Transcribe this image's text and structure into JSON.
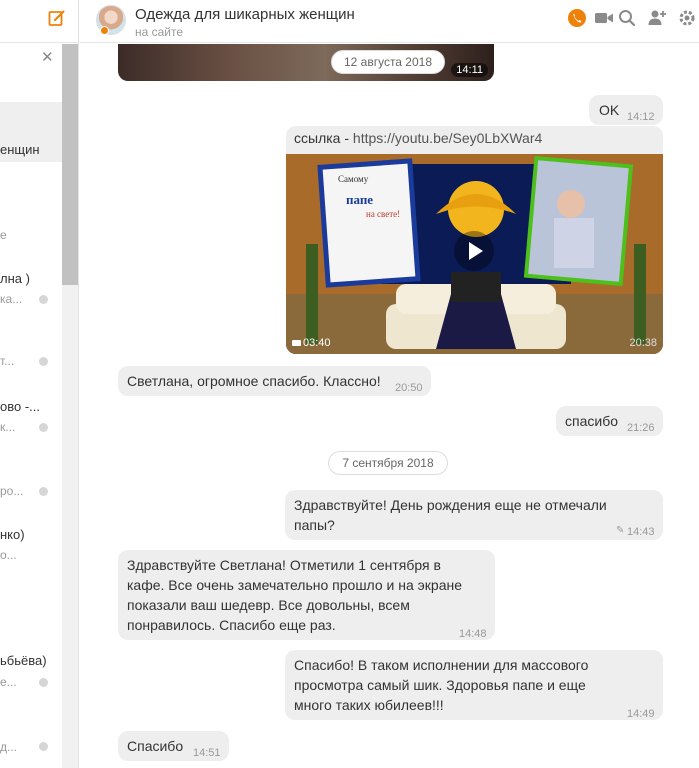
{
  "header": {
    "title": "Одежда для шикарных женщин",
    "status": "на сайте"
  },
  "sidebar": {
    "items": [
      {
        "name": "енщин",
        "sub": "",
        "active": true
      },
      {
        "name": "е",
        "sub": ""
      },
      {
        "name": "лна )",
        "sub": "ка..."
      },
      {
        "name": "",
        "sub": "т..."
      },
      {
        "name": "ово -...",
        "sub": "к..."
      },
      {
        "name": "",
        "sub": "ро..."
      },
      {
        "name": "нко)",
        "sub": "о..."
      },
      {
        "name": "ьбьёва)",
        "sub": "е..."
      },
      {
        "name": "",
        "sub": "д..."
      }
    ]
  },
  "messages": {
    "date1": "12 августа 2018",
    "img_time": "14:11",
    "ok": {
      "text": "OK",
      "time": "14:12"
    },
    "link": {
      "prefix": "ссылка - ",
      "url": "https://youtu.be/Sey0LbXWar4",
      "duration": "03:40",
      "time": "20:38"
    },
    "thanks_in": {
      "text": "Светлана, огромное спасибо. Классно!",
      "time": "20:50"
    },
    "thanks_out": {
      "text": "спасибо",
      "time": "21:26"
    },
    "date2": "7 сентября 2018",
    "hello_out": {
      "text": "Здравствуйте! День рождения еще не отмечали папы?",
      "time": "14:43"
    },
    "reply_in": {
      "text": "Здравствуйте Светлана! Отметили 1 сентября в кафе. Все очень замечательно прошло и на экране показали ваш шедевр. Все довольны, всем понравилось. Спасибо еще раз.",
      "time": "14:48"
    },
    "wish_out": {
      "text": "Спасибо! В таком исполнении для массового просмотра самый шик. Здоровья папе и еще много таких юбилеев!!!",
      "time": "14:49"
    },
    "final_in": {
      "text": "Спасибо",
      "time": "14:51"
    }
  },
  "video_text": {
    "line1": "Самому",
    "line2": "папе",
    "line3": "на свете!"
  },
  "colors": {
    "accent": "#ee8208",
    "bubble": "#eeeeee",
    "icon": "#8a8a8a"
  }
}
